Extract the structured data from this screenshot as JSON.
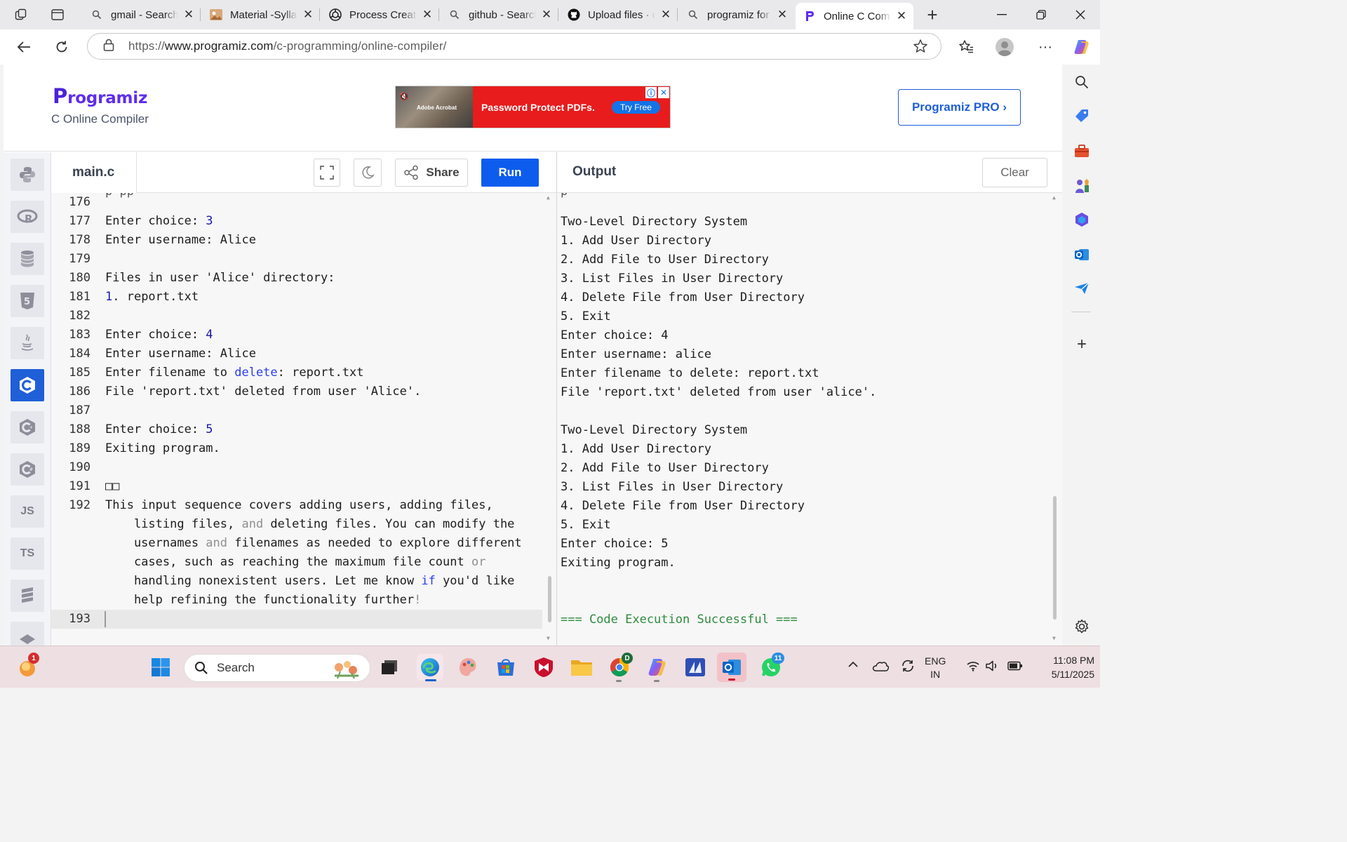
{
  "browser": {
    "tabs": [
      {
        "title": "gmail - Search",
        "icon": "search-icon"
      },
      {
        "title": "Material -Syllabus",
        "icon": "material-favicon"
      },
      {
        "title": "Process Creation",
        "icon": "openai-favicon"
      },
      {
        "title": "github - Search",
        "icon": "search-icon"
      },
      {
        "title": "Upload files · c",
        "icon": "github-favicon"
      },
      {
        "title": "programiz for c",
        "icon": "search-icon"
      },
      {
        "title": "Online C Compiler",
        "icon": "programiz-favicon"
      }
    ],
    "url_prefix": "https://",
    "url_host": "www.programiz.com",
    "url_path": "/c-programming/online-compiler/"
  },
  "site": {
    "brand": "rogramiz",
    "brand_initial": "P",
    "subtitle": "C Online Compiler",
    "ad_text": "Password Protect PDFs.",
    "ad_cta": "Try Free",
    "ad_brand": "Adobe Acrobat",
    "pro_button": "Programiz PRO ›"
  },
  "languages": [
    "python",
    "r",
    "sql",
    "html",
    "java",
    "c",
    "cpp",
    "csharp",
    "JS",
    "TS",
    "go",
    "php"
  ],
  "editor": {
    "filename": "main.c",
    "share_label": "Share",
    "run_label": "Run",
    "lines": [
      {
        "n": "176",
        "html": ""
      },
      {
        "n": "177",
        "html": "Enter choice: <span class=\"num\">3</span>"
      },
      {
        "n": "178",
        "html": "Enter username: Alice"
      },
      {
        "n": "179",
        "html": ""
      },
      {
        "n": "180",
        "html": "Files in user 'Alice' directory:"
      },
      {
        "n": "181",
        "html": "<span class=\"num\">1</span>. report.txt"
      },
      {
        "n": "182",
        "html": ""
      },
      {
        "n": "183",
        "html": "Enter choice: <span class=\"num\">4</span>"
      },
      {
        "n": "184",
        "html": "Enter username: Alice"
      },
      {
        "n": "185",
        "html": "Enter filename to <span class=\"kw\">delete</span>: report.txt"
      },
      {
        "n": "186",
        "html": "File 'report.txt' deleted from user 'Alice'."
      },
      {
        "n": "187",
        "html": ""
      },
      {
        "n": "188",
        "html": "Enter choice: <span class=\"num\">5</span>"
      },
      {
        "n": "189",
        "html": "Exiting program."
      },
      {
        "n": "190",
        "html": ""
      },
      {
        "n": "191",
        "html": "□□"
      },
      {
        "n": "192",
        "html": "This input sequence covers adding users, adding files,"
      },
      {
        "n": "",
        "html": "    listing files, <span class=\"op\">and</span> deleting files. You can modify the"
      },
      {
        "n": "",
        "html": "    usernames <span class=\"op\">and</span> filenames as needed to explore different"
      },
      {
        "n": "",
        "html": "    cases, such as reaching the maximum file count <span class=\"op\">or</span>"
      },
      {
        "n": "",
        "html": "    handling nonexistent users. Let me know <span class=\"kw\">if</span> you'd like"
      },
      {
        "n": "",
        "html": "    help refining the functionality further<span class=\"op\">!</span>"
      },
      {
        "n": "193",
        "html": "",
        "current": true
      }
    ]
  },
  "output": {
    "title": "Output",
    "clear_label": "Clear",
    "lines": [
      "",
      "Two-Level Directory System",
      "1. Add User Directory",
      "2. Add File to User Directory",
      "3. List Files in User Directory",
      "4. Delete File from User Directory",
      "5. Exit",
      "Enter choice: 4",
      "Enter username: alice",
      "Enter filename to delete: report.txt",
      "File 'report.txt' deleted from user 'alice'.",
      "",
      "Two-Level Directory System",
      "1. Add User Directory",
      "2. Add File to User Directory",
      "3. List Files in User Directory",
      "4. Delete File from User Directory",
      "5. Exit",
      "Enter choice: 5",
      "Exiting program.",
      "",
      "",
      "=== Code Execution Successful ==="
    ]
  },
  "taskbar": {
    "search_placeholder": "Search",
    "notification_count": "1",
    "chrome_badge": "D",
    "whatsapp_badge": "11",
    "language_line1": "ENG",
    "language_line2": "IN",
    "time": "11:08 PM",
    "date": "5/11/2025"
  },
  "colors": {
    "accent": "#0d5ced",
    "brand": "#5f2ded",
    "success": "#2e8b3e",
    "adRed": "#e81c1c"
  }
}
